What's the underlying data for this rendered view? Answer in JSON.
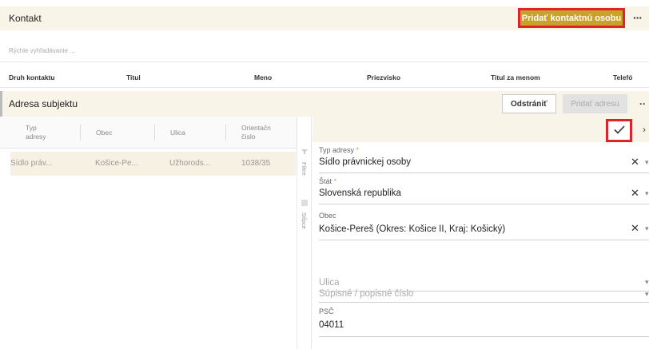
{
  "kontakt": {
    "title": "Kontakt",
    "add_button": "Pridať kontaktnú osobu",
    "search_placeholder": "Rýchle vyhľadávanie ...",
    "columns": [
      "Druh kontaktu",
      "Titul",
      "Meno",
      "Priezvisko",
      "Titul za menom",
      "Telefó"
    ]
  },
  "adresa": {
    "title": "Adresa subjektu",
    "remove_button": "Odstrániť",
    "add_button": "Pridať adresu",
    "grid_columns": [
      "Typ\nadresy",
      "Obec",
      "Ulica",
      "Orientačn\nčíslo"
    ],
    "rows": [
      {
        "typ": "Sídlo práv...",
        "obec": "Košice-Pe...",
        "ulica": "Užhorods...",
        "cislo": "1038/35"
      }
    ],
    "side_tabs": {
      "filters": "Filtre",
      "columns": "Stĺpce"
    }
  },
  "form": {
    "fields": [
      {
        "label": "Typ adresy",
        "required": true,
        "value": "Sídlo právnickej osoby"
      },
      {
        "label": "Štát",
        "required": true,
        "value": "Slovenská republika"
      },
      {
        "label": "Obec",
        "required": false,
        "value": "Košice-Pereš (Okres: Košice II, Kraj: Košický)"
      },
      {
        "label": "",
        "required": false,
        "placeholder": "Ulica"
      },
      {
        "label": "",
        "required": false,
        "placeholder": "Súpisné / popisné číslo"
      },
      {
        "label": "PSČ",
        "required": false,
        "value": "04011"
      }
    ]
  },
  "colors": {
    "accent": "#c9a227",
    "highlight_border": "#e0222a",
    "panel_bg": "#f8f4e8"
  },
  "icons": {
    "more": "more-icon",
    "save": "check-icon",
    "close": "close-icon",
    "clear": "clear-icon"
  }
}
